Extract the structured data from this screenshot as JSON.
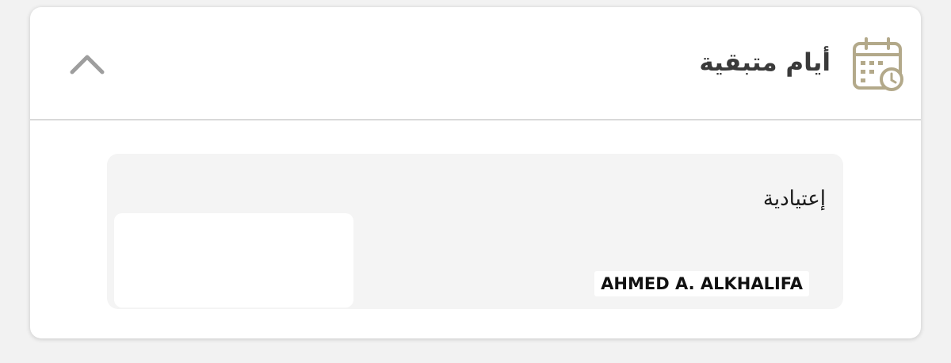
{
  "section": {
    "title": "أيام متبقية",
    "icon": "calendar-clock-icon",
    "toggle_icon": "chevron-up-icon"
  },
  "entries": [
    {
      "type_label": "إعتيادية",
      "name": "AHMED A. ALKHALIFA"
    }
  ],
  "colors": {
    "accent": "#b3a98a",
    "title_text": "#3a3a3a",
    "chevron": "#9e9e9e",
    "entry_bg": "#f4f4f4"
  }
}
